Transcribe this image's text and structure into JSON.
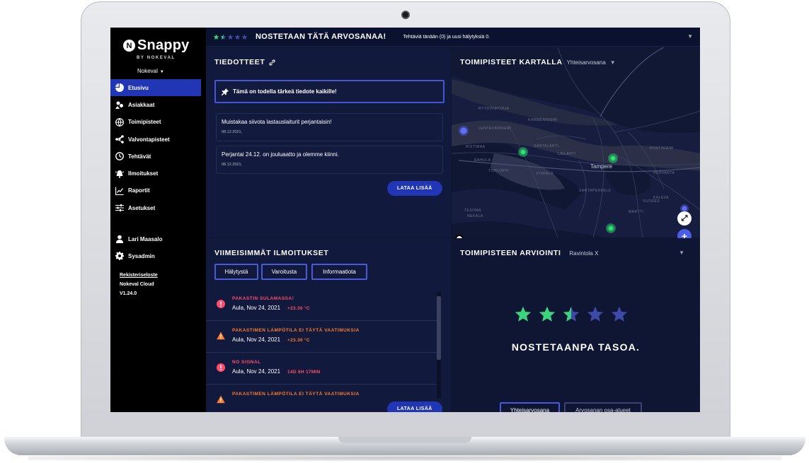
{
  "sidebar": {
    "brand": "Snappy",
    "brand_sub": "BY NOKEVAL",
    "organization": "Nokeval",
    "nav": [
      {
        "label": "Etusivu",
        "icon": "pie-chart-icon",
        "active": true
      },
      {
        "label": "Asiakkaat",
        "icon": "customers-icon"
      },
      {
        "label": "Toimipisteet",
        "icon": "globe-icon"
      },
      {
        "label": "Valvontapisteet",
        "icon": "network-icon"
      },
      {
        "label": "Tehtävät",
        "icon": "clock-icon"
      },
      {
        "label": "Ilmoitukset",
        "icon": "bell-alert-icon"
      },
      {
        "label": "Raportit",
        "icon": "chart-icon"
      },
      {
        "label": "Asetukset",
        "icon": "sliders-icon"
      }
    ],
    "user": {
      "label": "Lari Maasalo",
      "icon": "user-icon"
    },
    "admin": {
      "label": "Sysadmin",
      "icon": "gear-icon"
    },
    "links": {
      "privacy": "Rekisteriseloste",
      "cloud": "Nokeval Cloud",
      "version": "V1.24.0"
    }
  },
  "topbar": {
    "rating": 1.5,
    "title": "NOSTETAAN TÄTÄ ARVOSANAA!",
    "info": "Tehtäviä tänään (0) ja uusi hälytyksiä 0."
  },
  "announcements": {
    "title": "TIEDOTTEET",
    "pinned": "Tämä on todella tärkeä tiedote kaikille!",
    "items": [
      {
        "text": "Muistakaa siivota lastauslaiturit perjantaisin!",
        "date": "08.12.2021,"
      },
      {
        "text": "Perjantai 24.12. on jouluaatto ja olemme kiinni.",
        "date": "08.12.2021,"
      }
    ],
    "load_more": "LATAA LISÄÄ"
  },
  "map": {
    "title": "TOIMIPISTEET KARTALLA",
    "selector": "Yhteisarvosana",
    "city_label": "Tampere",
    "attribution": "mapbox",
    "place_labels": [
      "RYYDÖNPOHJA",
      "LENTÄVÄNNIEMI",
      "RISTIMAA",
      "SANTALAHTI",
      "KAMMENNIEMI",
      "RAHOLA",
      "TOHLOPPI",
      "TESOMA",
      "PISPALA",
      "SANTAPERKELE",
      "LIELAHTI",
      "KOSTINIEMI",
      "HERVANTA",
      "VUORES",
      "KALEVA",
      "MARTTI",
      "NEKALA"
    ],
    "zoom_in": "+",
    "zoom_out": "−",
    "accent_green": "#2fd36f",
    "accent_blue": "#4b5ce6"
  },
  "alerts": {
    "title": "VIIMEISIMMÄT ILMOITUKSET",
    "filters": [
      "Hälytystä",
      "Varoitusta",
      "Informaatiota"
    ],
    "items": [
      {
        "type": "error",
        "title": "PAKASTIN SULAMASSA!",
        "date": "Aula, Nov 24, 2021",
        "value": "+23.30 °C"
      },
      {
        "type": "warning",
        "title": "PAKASTIMEN LÄMPÖTILA EI TÄYTÄ VAATIMUKSIA",
        "date": "Aula, Nov 24, 2021",
        "value": "+23.30 °C"
      },
      {
        "type": "error",
        "title": "NO SIGNAL",
        "date": "Aula, Nov 24, 2021",
        "value": "14D 6H 17MIN"
      },
      {
        "type": "warning",
        "title": "PAKASTIMEN LÄMPÖTILA EI TÄYTÄ VAATIMUKSIA",
        "date": "",
        "value": ""
      }
    ],
    "load_more": "LATAA LISÄÄ",
    "colors": {
      "error": "#ff4d6d",
      "warning": "#ff7a2b"
    }
  },
  "rating": {
    "title": "TOIMIPISTEEN ARVIOINTI",
    "location": "Ravintola X",
    "value": 2.5,
    "max": 5,
    "message": "NOSTETAANPA TASOA.",
    "tabs": [
      "Yhteisarvosana",
      "Arvosanan osa-alueet"
    ],
    "star_color": "#39d47c",
    "star_empty_color": "#3d4aa8"
  }
}
